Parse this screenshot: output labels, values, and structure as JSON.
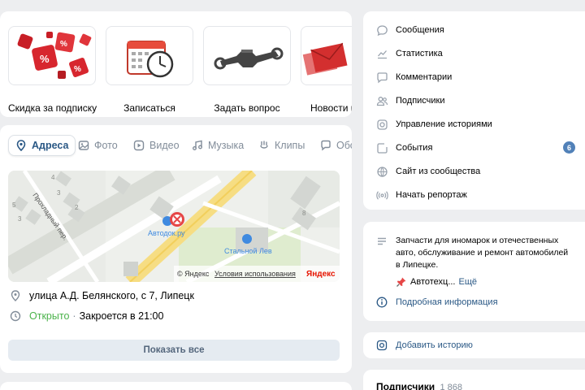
{
  "shortcuts": [
    {
      "label": "Скидка за подписку",
      "icon": "discount-dice-icon"
    },
    {
      "label": "Записаться",
      "icon": "calendar-clock-icon"
    },
    {
      "label": "Задать вопрос",
      "icon": "wrench-icon"
    },
    {
      "label": "Новости и",
      "icon": "envelope-icon"
    }
  ],
  "tabs": [
    {
      "label": "Адреса",
      "icon": "location-pin-icon",
      "active": true
    },
    {
      "label": "Фото",
      "icon": "photo-icon"
    },
    {
      "label": "Видео",
      "icon": "video-icon"
    },
    {
      "label": "Музыка",
      "icon": "music-icon"
    },
    {
      "label": "Клипы",
      "icon": "clips-icon"
    },
    {
      "label": "Обс",
      "icon": "discussion-icon"
    }
  ],
  "map": {
    "place_label": "Автодок.ру",
    "street_label": "Прохладный пер.",
    "poi_label": "Стальной Лев",
    "house_numbers": [
      "4",
      "3",
      "2",
      "5",
      "3",
      "8"
    ],
    "copyright": "© Яндекс",
    "terms": "Условия использования",
    "brand": "Яндекс"
  },
  "address": {
    "text": "улица А.Д. Белянского, с 7, Липецк",
    "status_open": "Открыто",
    "separator": "·",
    "closes": "Закроется в 21:00",
    "show_all": "Показать все"
  },
  "menu": [
    {
      "label": "Сообщения",
      "icon": "message-icon"
    },
    {
      "label": "Статистика",
      "icon": "stats-icon"
    },
    {
      "label": "Комментарии",
      "icon": "comment-icon"
    },
    {
      "label": "Подписчики",
      "icon": "subscribers-icon"
    },
    {
      "label": "Управление историями",
      "icon": "stories-icon"
    },
    {
      "label": "События",
      "icon": "events-icon",
      "badge": "6"
    },
    {
      "label": "Сайт из сообщества",
      "icon": "globe-icon"
    },
    {
      "label": "Начать репортаж",
      "icon": "broadcast-icon"
    }
  ],
  "about": {
    "description": "Запчасти для иномарок и отечественных авто, обслуживание и ремонт автомобилей в Липецке.",
    "pinned": "Автотехц...",
    "more": "Ещё",
    "details": "Подробная информация"
  },
  "story": {
    "label": "Добавить историю"
  },
  "subscribers": {
    "title": "Подписчики",
    "count": "1 868"
  },
  "colors": {
    "accent": "#2a5885",
    "open_green": "#4bb34b",
    "badge": "#5181b8",
    "background": "#edeef0"
  }
}
